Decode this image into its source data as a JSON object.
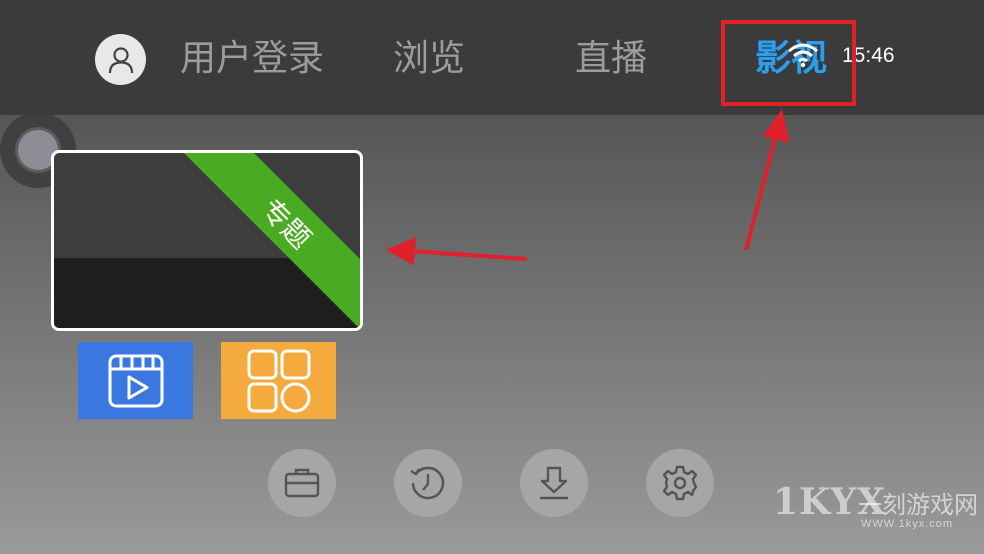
{
  "header": {
    "nav": [
      {
        "label": "用户登录",
        "active": false
      },
      {
        "label": "浏览",
        "active": false
      },
      {
        "label": "直播",
        "active": false
      },
      {
        "label": "影视",
        "active": true
      }
    ],
    "clock": "15:46"
  },
  "card": {
    "ribbon_label": "专题",
    "ribbon_color": "#4aaa22"
  },
  "tiles": [
    {
      "icon": "film-play-icon",
      "color": "#3a77e0"
    },
    {
      "icon": "app-grid-icon",
      "color": "#f5aa3d"
    }
  ],
  "bottom_buttons": [
    {
      "icon": "briefcase-icon"
    },
    {
      "icon": "history-icon"
    },
    {
      "icon": "download-icon"
    },
    {
      "icon": "settings-icon"
    }
  ],
  "watermark": {
    "logo": "1KYX",
    "text": "一刻游戏网",
    "url": "WWW.1kyx.com"
  },
  "annotation": {
    "color": "#e0202a"
  }
}
